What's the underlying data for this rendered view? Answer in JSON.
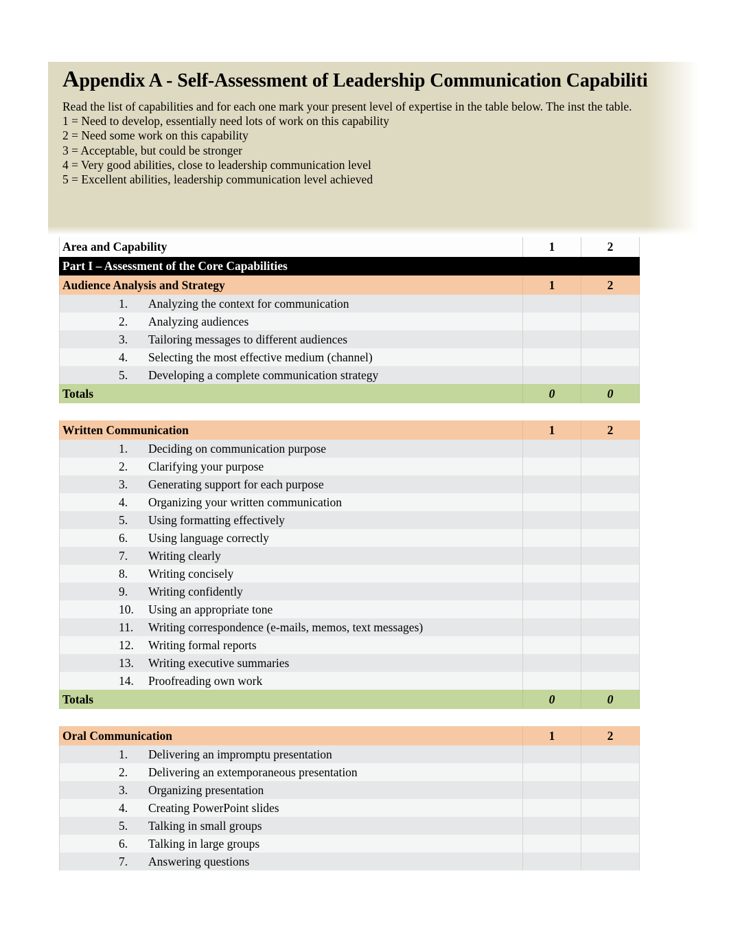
{
  "document": {
    "title_lead": "A",
    "title_rest": "ppendix A - Self-Assessment of Leadership Communication Capabiliti",
    "intro_paragraph": "Read the list of capabilities and for each one mark your present level of expertise in the table below.  The inst the table.",
    "scale": [
      "1 = Need to develop, essentially need lots of work on this capability",
      "2 = Need some work on this capability",
      "3 = Acceptable, but could be stronger",
      "4 = Very good abilities, close to leadership communication level",
      "5 = Excellent abilities, leadership communication level achieved"
    ]
  },
  "colors": {
    "header_block": "#dedac2",
    "section_header": "#f6c9a4",
    "totals_row": "#c3d69b",
    "part_banner": "#000000",
    "row_stripe_dark": "#e6e7e8",
    "row_stripe_light": "#f4f5f5"
  },
  "table": {
    "column_header_label": "Area and Capability",
    "rating_columns": [
      "1",
      "2"
    ],
    "part_banner": "Part I – Assessment of the Core Capabilities",
    "totals_label": "Totals",
    "sections": [
      {
        "name": "Audience Analysis and Strategy",
        "rating_columns": [
          "1",
          "2"
        ],
        "items": [
          "Analyzing the context for communication",
          "Analyzing audiences",
          "Tailoring messages to different audiences",
          "Selecting the most effective medium (channel)",
          "Developing a complete communication strategy"
        ],
        "totals": [
          "0",
          "0"
        ]
      },
      {
        "name": "Written Communication",
        "rating_columns": [
          "1",
          "2"
        ],
        "items": [
          "Deciding on communication purpose",
          "Clarifying your purpose",
          "Generating support for each purpose",
          "Organizing your written communication",
          "Using formatting effectively",
          "Using language correctly",
          "Writing clearly",
          "Writing concisely",
          "Writing confidently",
          "Using an appropriate tone",
          "Writing correspondence (e-mails, memos, text messages)",
          "Writing formal reports",
          "Writing executive summaries",
          "Proofreading own work"
        ],
        "totals": [
          "0",
          "0"
        ]
      },
      {
        "name": "Oral Communication",
        "rating_columns": [
          "1",
          "2"
        ],
        "items": [
          "Delivering an impromptu presentation",
          "Delivering an extemporaneous presentation",
          "Organizing presentation",
          "Creating PowerPoint slides",
          "Talking in small groups",
          "Talking in large groups",
          "Answering questions"
        ],
        "totals": null
      }
    ]
  }
}
